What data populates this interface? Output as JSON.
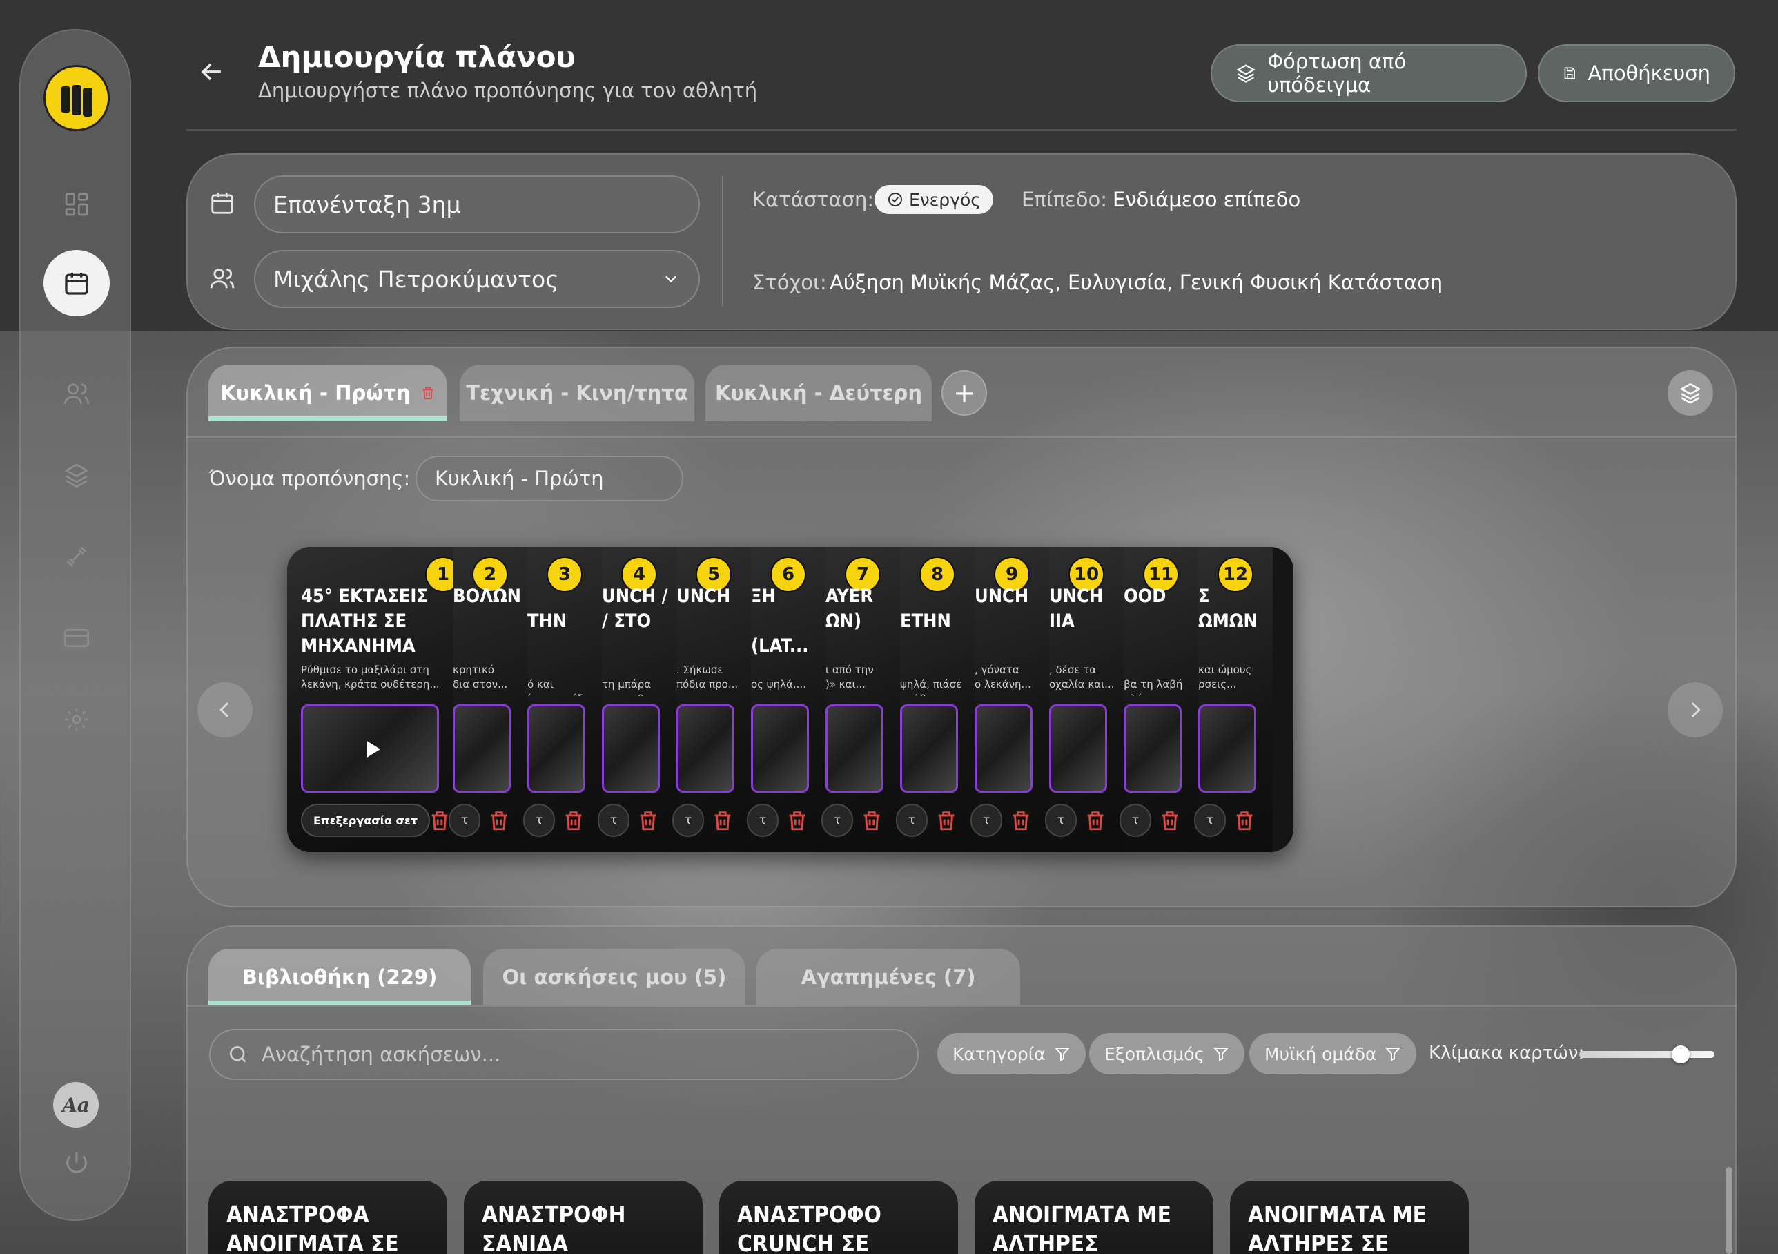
{
  "header": {
    "title": "Δημιουργία πλάνου",
    "subtitle": "Δημιουργήστε πλάνο προπόνησης για τον αθλητή",
    "load_template": "Φόρτωση από υπόδειγμα",
    "save": "Αποθήκευση"
  },
  "plan": {
    "name": "Επανένταξη 3ημ",
    "athlete": "Μιχάλης Πετροκύμαντος",
    "status_label": "Κατάσταση:",
    "status_value": "Ενεργός",
    "level_label": "Επίπεδο:",
    "level_value": "Ενδιάμεσο επίπεδο",
    "goals_label": "Στόχοι:",
    "goals_value": "Αύξηση Μυϊκής Μάζας, Ευλυγισία, Γενική Φυσική Κατάσταση"
  },
  "workout_tabs": [
    "Κυκλική - Πρώτη",
    "Τεχνική - Κινη/τητα",
    "Κυκλική - Δεύτερη"
  ],
  "workout_name_label": "Όνομα προπόνησης:",
  "workout_name_value": "Κυκλική - Πρώτη",
  "exercises": [
    {
      "n": "1",
      "title": "45° ΕΚΤΑΣΕΙΣ\nΠΛΑΤΗΣ ΣΕ\nΜΗΧΑΝΗΜΑ",
      "desc": "Ρύθμισε το μαξιλάρι στη\nλεκάνη, κράτα ουδέτερη..."
    },
    {
      "n": "2",
      "title": "ΒΟΛΩΝ",
      "desc": "κρητικό\nδια στον..."
    },
    {
      "n": "3",
      "title": "\nTHN",
      "desc": "\nό και\nίσω σε τόξ..."
    },
    {
      "n": "4",
      "title": "UNCH /\n/ ΣΤΟ",
      "desc": "\nτη μπάρα\nτη σταθερ..."
    },
    {
      "n": "5",
      "title": "UNCH",
      "desc": ". Σήκωσε\nπόδια προ..."
    },
    {
      "n": "6",
      "title": "ΞΗ\n\n(LAT...",
      "desc": "\nος ψηλά...."
    },
    {
      "n": "7",
      "title": "AYER\nΩN)",
      "desc": "ι από την\n)» και..."
    },
    {
      "n": "8",
      "title": "\nETHN",
      "desc": "\nψηλά, πιάσε\nτράβα σε..."
    },
    {
      "n": "9",
      "title": "UNCH",
      "desc": ", γόνατα\nο λεκάνη..."
    },
    {
      "n": "10",
      "title": "UNCH\nΙΙΑ",
      "desc": ", δέσε τα\nοχαλία και..."
    },
    {
      "n": "11",
      "title": "ΟΟD",
      "desc": "\nβα τη λαβή\nηλά σε..."
    },
    {
      "n": "12",
      "title": "Σ ΩΜΩΝ",
      "desc": "και ώμους\nρσεις..."
    }
  ],
  "edit_sets": "Επεξεργασία σετ",
  "set_tag": "τ",
  "library_tabs": [
    "Βιβλιοθήκη (229)",
    "Οι ασκήσεις μου (5)",
    "Αγαπημένες (7)"
  ],
  "search": {
    "placeholder": "Αναζήτηση ασκήσεων..."
  },
  "filters": [
    "Κατηγορία",
    "Εξοπλισμός",
    "Μυϊκή ομάδα"
  ],
  "scale_label": "Κλίμακα καρτών:",
  "card_scale": 0.75,
  "library_cards": [
    "ΑΝΑΣΤΡΟΦΑ\nΑΝΟΙΓΜΑΤΑ ΣΕ",
    "ΑΝΑΣΤΡΟΦΗ ΣΑΝΙΔΑ\nΜΕ ΛΥΓΙΣΜΕΝΑ",
    "ΑΝΑΣΤΡΟΦΟ\nCRUNCH ΣΕ",
    "ΑΝΟΙΓΜΑΤΑ ΜΕ\nΑΛΤΗΡΕΣ",
    "ΑΝΟΙΓΜΑΤΑ ΜΕ\nΑΛΤΗΡΕΣ ΣΕ ΜΠΑΛΑ"
  ],
  "font_toggle": "Aa",
  "colors": {
    "accent": "#a9e6cf",
    "badge_yellow": "#f7d30f",
    "video_border": "#8b3bd6",
    "delete": "#e04848"
  }
}
